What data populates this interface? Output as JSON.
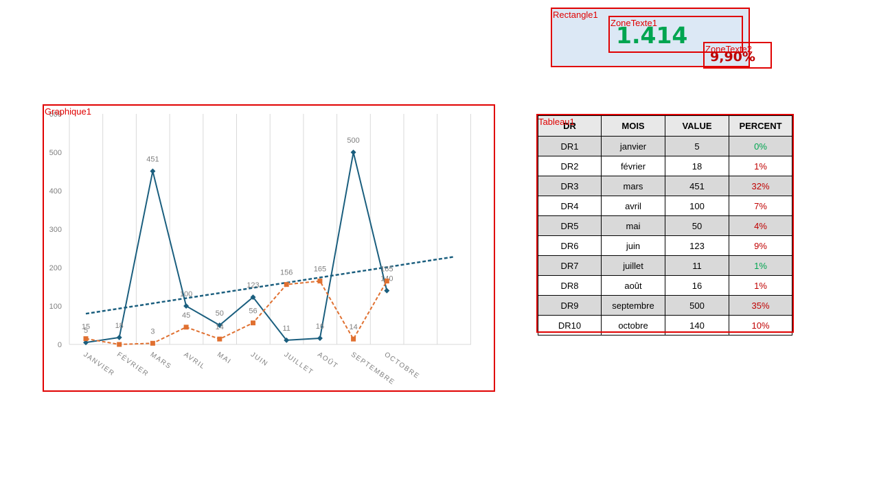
{
  "labels": {
    "rectangle": "Rectangle1",
    "textbox1": "ZoneTexte1",
    "textbox2": "ZoneTexte2",
    "chart": "Graphique1",
    "table": "Tableau1"
  },
  "kpi": {
    "value": "1.414",
    "percent": "9,90%"
  },
  "colors": {
    "series1": "#1a5e7e",
    "series2": "#e07030",
    "kpi_value": "#00a550",
    "kpi_percent": "#c00000",
    "selection": "#e00000",
    "pct_green": "#00a550",
    "pct_red": "#c00000"
  },
  "chart_data": {
    "type": "line",
    "categories": [
      "JANVIER",
      "FÉVRIER",
      "MARS",
      "AVRIL",
      "MAI",
      "JUIN",
      "JUILLET",
      "AOÛT",
      "SEPTEMBRE",
      "OCTOBRE"
    ],
    "ylim": [
      0,
      600
    ],
    "yticks": [
      "0",
      "100",
      "200",
      "300",
      "400",
      "500",
      "600"
    ],
    "grid": "vertical",
    "legend": "none",
    "series": [
      {
        "values": [
          5,
          18,
          451,
          100,
          50,
          123,
          11,
          16,
          500,
          140
        ],
        "labels": [
          "5",
          "18",
          "451",
          "100",
          "50",
          "123",
          "11",
          "16",
          "500",
          "140"
        ],
        "marker": "diamond",
        "style": "solid"
      },
      {
        "values": [
          15,
          0,
          3,
          45,
          14,
          56,
          156,
          165,
          14,
          165
        ],
        "labels": [
          "15",
          "",
          "3",
          "45",
          "14",
          "56",
          "156",
          "165",
          "14",
          "165"
        ],
        "marker": "square",
        "style": "dashed"
      }
    ],
    "trendline": {
      "series": 0,
      "from": 80,
      "to": 228,
      "style": "dashed"
    }
  },
  "table": {
    "headers": [
      "DR",
      "MOIS",
      "VALUE",
      "PERCENT"
    ],
    "rows": [
      {
        "dr": "DR1",
        "mois": "janvier",
        "value": "5",
        "percent": "0%",
        "status": "green"
      },
      {
        "dr": "DR2",
        "mois": "février",
        "value": "18",
        "percent": "1%",
        "status": "red"
      },
      {
        "dr": "DR3",
        "mois": "mars",
        "value": "451",
        "percent": "32%",
        "status": "red"
      },
      {
        "dr": "DR4",
        "mois": "avril",
        "value": "100",
        "percent": "7%",
        "status": "red"
      },
      {
        "dr": "DR5",
        "mois": "mai",
        "value": "50",
        "percent": "4%",
        "status": "red"
      },
      {
        "dr": "DR6",
        "mois": "juin",
        "value": "123",
        "percent": "9%",
        "status": "red"
      },
      {
        "dr": "DR7",
        "mois": "juillet",
        "value": "11",
        "percent": "1%",
        "status": "green"
      },
      {
        "dr": "DR8",
        "mois": "août",
        "value": "16",
        "percent": "1%",
        "status": "red"
      },
      {
        "dr": "DR9",
        "mois": "septembre",
        "value": "500",
        "percent": "35%",
        "status": "red"
      },
      {
        "dr": "DR10",
        "mois": "octobre",
        "value": "140",
        "percent": "10%",
        "status": "red"
      }
    ]
  }
}
